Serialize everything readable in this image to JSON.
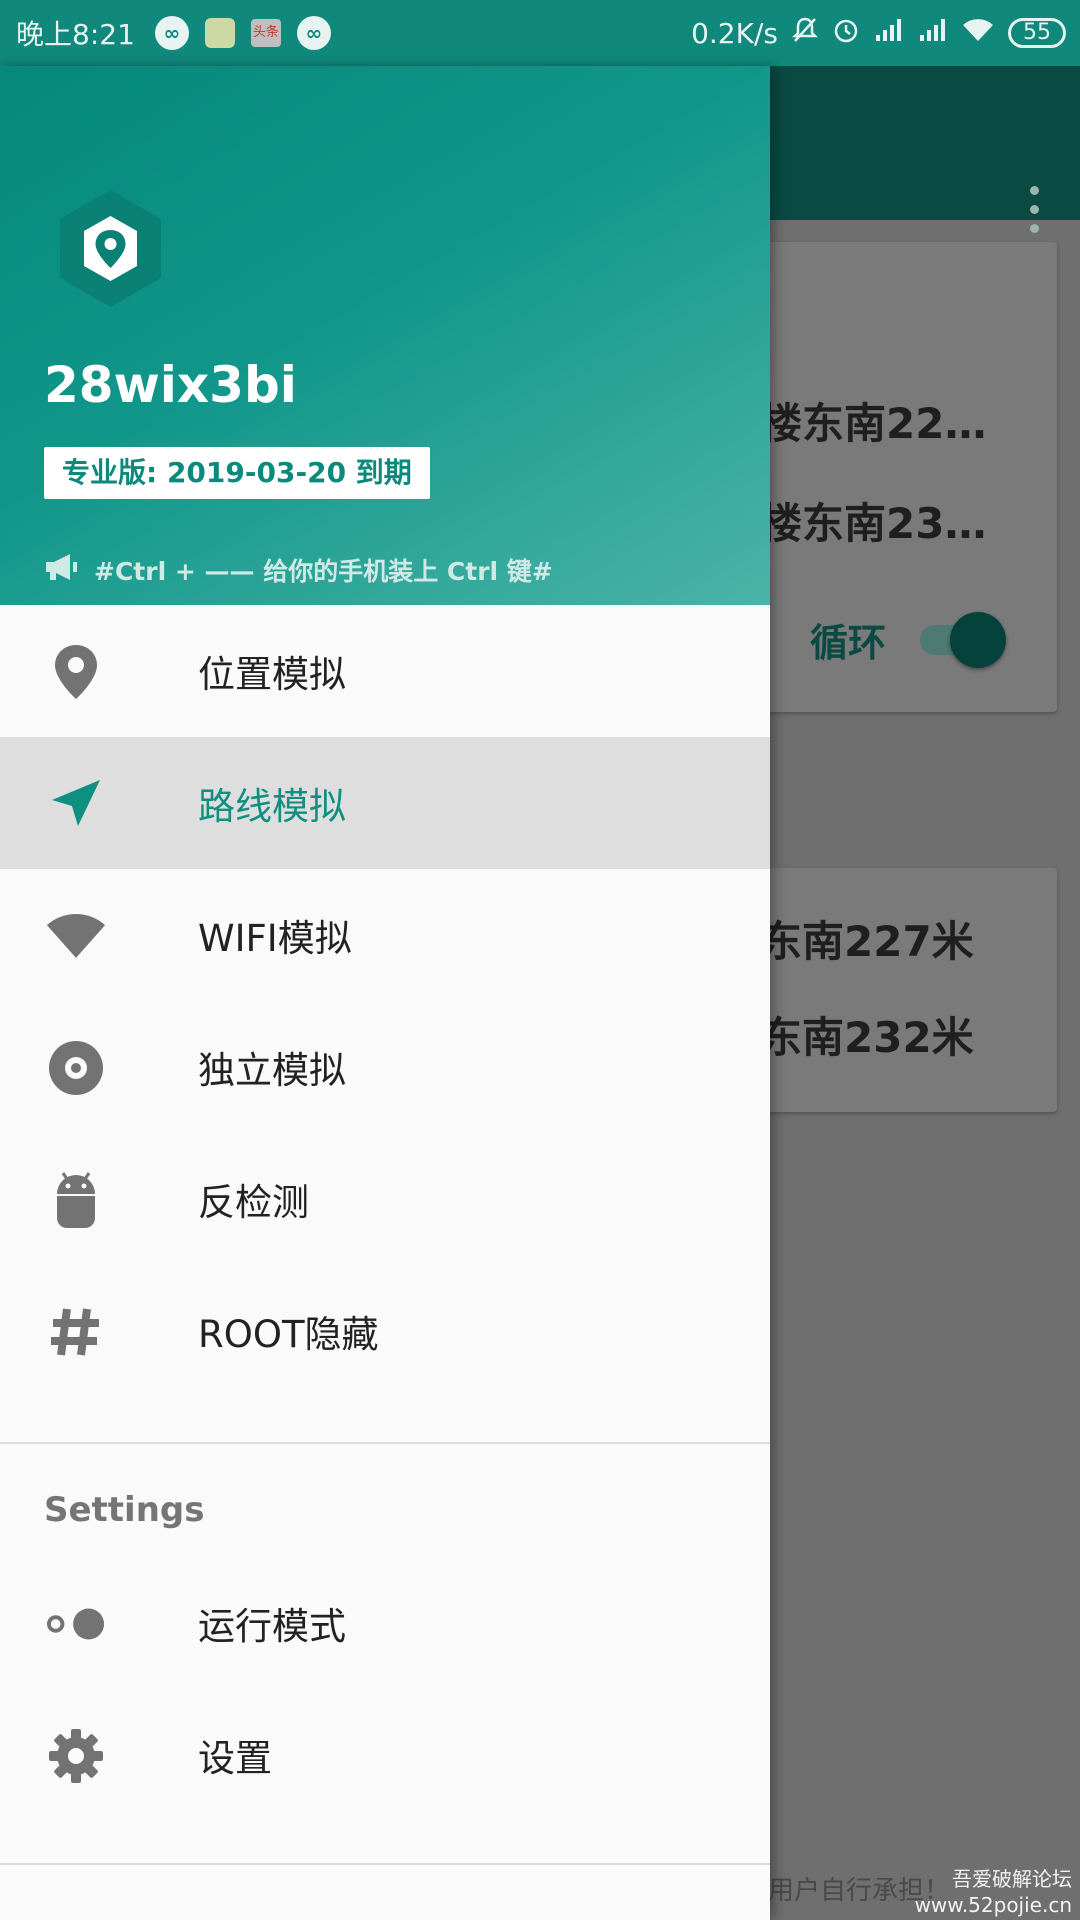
{
  "status_bar": {
    "time": "晚上8:21",
    "news_icon_text": "头条",
    "network_speed": "0.2K/s",
    "battery": "55"
  },
  "drawer": {
    "username": "28wix3bi",
    "license": "专业版: 2019-03-20 到期",
    "announcement": "#Ctrl + —— 给你的手机装上 Ctrl 键#",
    "menu": [
      {
        "label": "位置模拟",
        "icon": "location-pin-icon"
      },
      {
        "label": "路线模拟",
        "icon": "navigation-arrow-icon",
        "active": true
      },
      {
        "label": "WIFI模拟",
        "icon": "wifi-icon"
      },
      {
        "label": "独立模拟",
        "icon": "disc-icon"
      },
      {
        "label": "反检测",
        "icon": "android-icon"
      },
      {
        "label": "ROOT隐藏",
        "icon": "hash-icon"
      }
    ],
    "settings_section": "Settings",
    "settings_menu": [
      {
        "label": "运行模式",
        "icon": "toggle-mode-icon"
      },
      {
        "label": "设置",
        "icon": "gear-icon"
      }
    ]
  },
  "background": {
    "card1_line1": "楼东南22…",
    "card1_line2": "楼东南23…",
    "loop_label": "循环",
    "loop_enabled": true,
    "card2_line1": "东南227米",
    "card2_line2": "东南232米",
    "footer": "用户自行承担！"
  },
  "watermark": {
    "line1": "吾爱破解论坛",
    "line2": "www.52pojie.cn"
  },
  "colors": {
    "accent": "#0f8f80",
    "header_start": "#06887a",
    "header_end": "#4bb3a8",
    "active_row": "#dedede"
  }
}
